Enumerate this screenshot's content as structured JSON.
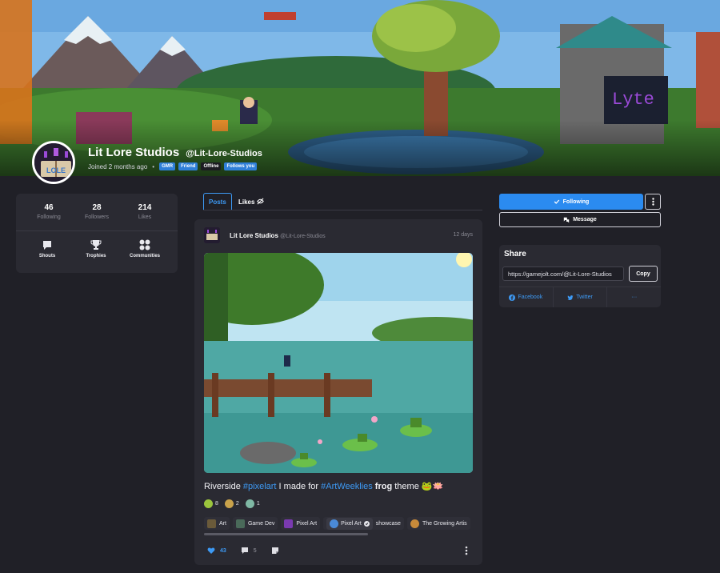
{
  "profile": {
    "display_name": "Lit Lore Studios",
    "username": "@Lit-Lore-Studios",
    "joined": "Joined 2 months ago",
    "tags": [
      "GMR",
      "Friend",
      "Offline",
      "Follows you"
    ]
  },
  "stats": [
    {
      "value": "46",
      "label": "Following"
    },
    {
      "value": "28",
      "label": "Followers"
    },
    {
      "value": "214",
      "label": "Likes"
    }
  ],
  "quick_links": [
    {
      "label": "Shouts",
      "icon": "speech-bubble-icon"
    },
    {
      "label": "Trophies",
      "icon": "trophy-icon"
    },
    {
      "label": "Communities",
      "icon": "grid-dots-icon"
    }
  ],
  "tabs": {
    "posts": "Posts",
    "likes": "Likes"
  },
  "post": {
    "author": "Lit Lore Studios",
    "handle": "@Lit-Lore-Studios",
    "time": "12 days",
    "text": {
      "t1": "Riverside ",
      "h1": "#pixelart",
      "t2": " I made for ",
      "h2": "#ArtWeeklies",
      "t3": " ",
      "b1": "frog",
      "t4": " theme ",
      "emoji": "🐸🪷"
    },
    "reactions": [
      {
        "count": "8",
        "color": "#9bc53d"
      },
      {
        "count": "2",
        "color": "#c9a24b"
      },
      {
        "count": "1",
        "color": "#7fb8a4"
      }
    ],
    "communities": [
      "Art",
      "Game Dev",
      "Pixel Art",
      "Pixel Art",
      "showcase",
      "The Growing Artis"
    ],
    "likes": "43",
    "comments": "5"
  },
  "actions": {
    "following": "Following",
    "message": "Message"
  },
  "share": {
    "title": "Share",
    "url": "https://gamejolt.com/@Lit-Lore-Studios",
    "copy": "Copy",
    "facebook": "Facebook",
    "twitter": "Twitter",
    "more": "···"
  },
  "colors": {
    "accent": "#2b8bf0",
    "background": "#202027",
    "card": "#2a2a32"
  }
}
